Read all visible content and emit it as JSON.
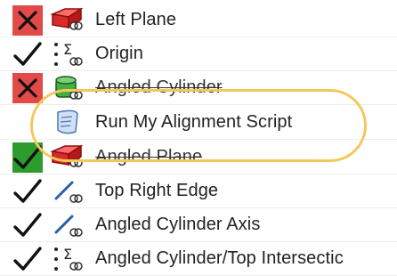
{
  "feature_tree": {
    "items": [
      {
        "label": "Left Plane",
        "status": "failed",
        "type_icon": "plane-icon"
      },
      {
        "label": "Origin",
        "status": "ok",
        "type_icon": "origin-icon"
      },
      {
        "label": "Angled Cylinder",
        "status": "failed",
        "type_icon": "cylinder-icon"
      },
      {
        "label": "Run My Alignment Script",
        "status": "none",
        "type_icon": "script-icon"
      },
      {
        "label": "Angled Plane",
        "status": "suppressed",
        "type_icon": "plane-icon"
      },
      {
        "label": "Top Right Edge",
        "status": "ok",
        "type_icon": "edge-icon"
      },
      {
        "label": "Angled Cylinder Axis",
        "status": "ok",
        "type_icon": "axis-icon"
      },
      {
        "label": "Angled Cylinder/Top Intersectic",
        "status": "ok",
        "type_icon": "origin-icon"
      }
    ]
  },
  "colors": {
    "failed": "#e24a4a",
    "suppressed": "#2d9b2d",
    "highlight": "#f3c85a"
  }
}
